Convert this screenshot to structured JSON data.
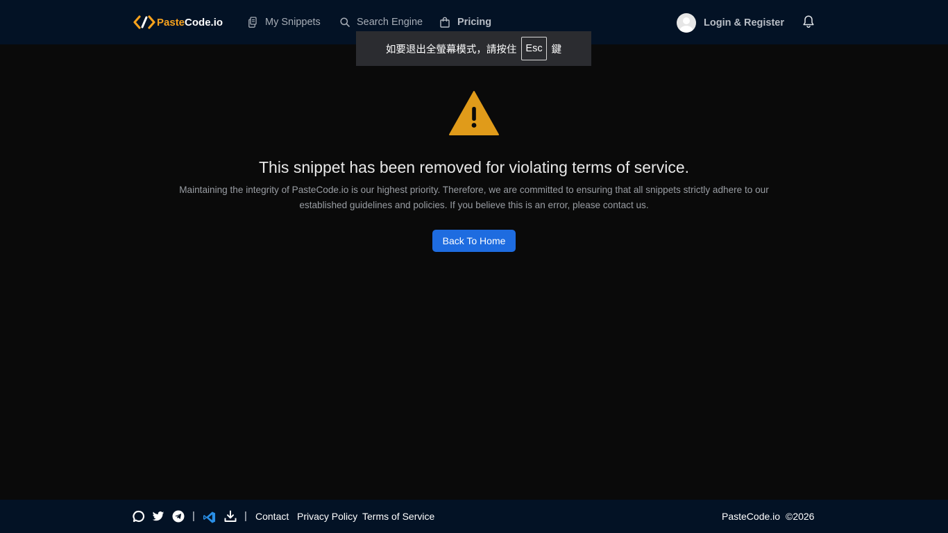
{
  "header": {
    "brand_prefix": "Paste",
    "brand_suffix": "Code.io",
    "nav": {
      "my_snippets": "My Snippets",
      "search_engine": "Search Engine",
      "pricing": "Pricing"
    },
    "login_label": "Login & Register"
  },
  "fullscreen_notice": {
    "before": "如要退出全螢幕模式，請按住",
    "key": "Esc",
    "after": "鍵"
  },
  "main": {
    "headline": "This snippet has been removed for violating terms of service.",
    "description": "Maintaining the integrity of PasteCode.io is our highest priority. Therefore, we are committed to ensuring that all snippets strictly adhere to our established guidelines and policies. If you believe this is an error, please contact us.",
    "button_label": "Back To Home"
  },
  "footer": {
    "separator": "|",
    "links": {
      "contact": "Contact",
      "privacy": "Privacy Policy",
      "terms": "Terms of Service"
    },
    "site_name": "PasteCode.io",
    "copyright": "©2026"
  },
  "icons": {
    "logo": "code-brackets-icon",
    "my_snippets": "document-copy-icon",
    "search": "search-icon",
    "pricing": "shopping-bag-icon",
    "notifications": "bell-icon",
    "warning": "warning-triangle-icon",
    "footer": [
      "chat-bubble-icon",
      "twitter-icon",
      "telegram-icon",
      "vscode-icon",
      "download-icon"
    ]
  },
  "colors": {
    "accent_orange": "#f7a21d",
    "navbar_bg": "#031225",
    "page_bg": "#0a0a0a",
    "warning": "#e09b1a",
    "button_blue": "#1e6ce0"
  }
}
